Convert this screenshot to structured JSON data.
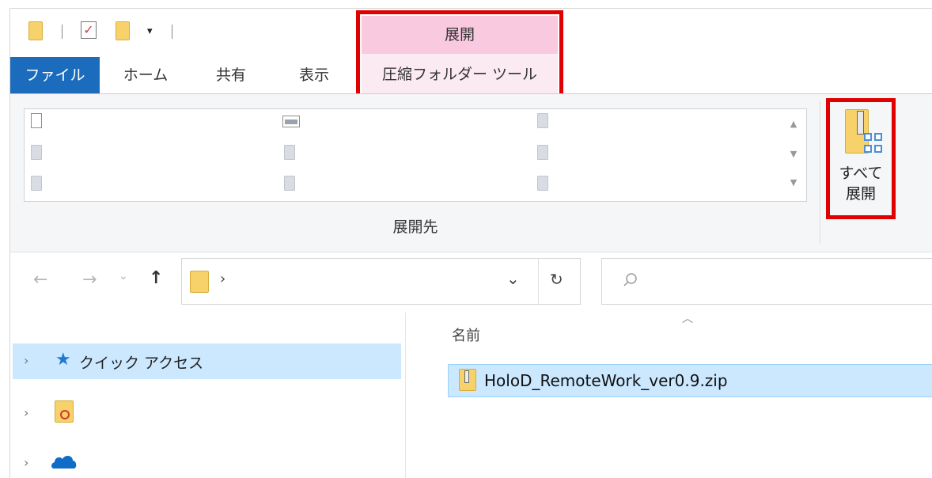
{
  "ribbon": {
    "contextual_header": "展開",
    "tabs": [
      "ファイル",
      "ホーム",
      "共有",
      "表示",
      "圧縮フォルダー ツール"
    ],
    "active_tab": "ファイル",
    "group_label": "展開先",
    "extract_all_label_line1": "すべて",
    "extract_all_label_line2": "展開"
  },
  "address_bar": {
    "path_separator": "›",
    "dropdown_glyph": "⌄",
    "refresh_glyph": "↻",
    "back_glyph": "←",
    "forward_glyph": "→",
    "recent_glyph": "⌄",
    "up_glyph": "↑"
  },
  "navigation_pane": {
    "items": [
      {
        "label": "クイック アクセス",
        "icon": "star-icon",
        "selected": true
      },
      {
        "label": "",
        "icon": "creative-cloud-folder-icon",
        "selected": false
      },
      {
        "label": "",
        "icon": "onedrive-cloud-icon",
        "selected": false
      }
    ]
  },
  "file_list": {
    "column_header": "名前",
    "files": [
      {
        "name": "HoloD_RemoteWork_ver0.9.zip",
        "icon": "zip-folder-icon",
        "selected": true
      }
    ]
  },
  "colors": {
    "file_tab": "#1c6cbd",
    "contextual_header": "#f9c9df",
    "contextual_tab": "#fbeaf2",
    "highlight_box": "#e00000",
    "selection": "#cce8ff"
  }
}
